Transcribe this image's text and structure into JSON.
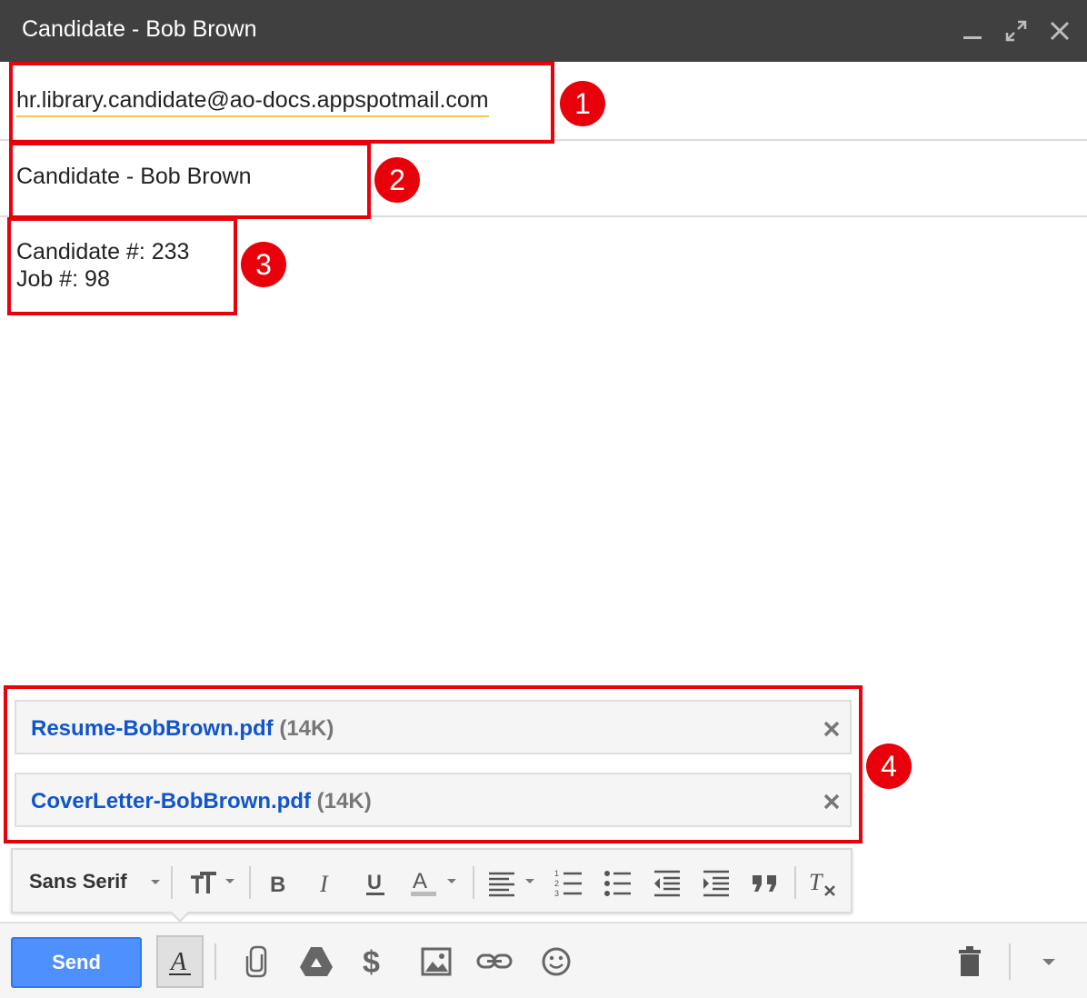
{
  "window": {
    "title": "Candidate - Bob Brown",
    "controls": [
      "minimize-icon",
      "expand-icon",
      "close-icon"
    ],
    "title_bar_color": "#404040"
  },
  "compose": {
    "to_value": "hr.library.candidate@ao-docs.appspotmail.com",
    "subject_value": "Candidate - Bob Brown",
    "body_lines": [
      "Candidate #: 233",
      "Job #: 98"
    ]
  },
  "annotations": {
    "color": "#e8000b",
    "labels": [
      "1",
      "2",
      "3",
      "4"
    ]
  },
  "attachments": [
    {
      "name": "Resume-BobBrown.pdf",
      "size": "(14K)"
    },
    {
      "name": "CoverLetter-BobBrown.pdf",
      "size": "(14K)"
    }
  ],
  "formatting_toolbar": {
    "font": "Sans Serif",
    "icons": [
      "font-size-icon",
      "bold-icon",
      "italic-icon",
      "underline-icon",
      "text-color-icon",
      "align-icon",
      "numbered-list-icon",
      "bulleted-list-icon",
      "indent-less-icon",
      "indent-more-icon",
      "quote-icon",
      "remove-formatting-icon"
    ]
  },
  "bottom_bar": {
    "send_label": "Send",
    "send_color": "#4d90fe",
    "icons": [
      "formatting-toggle-icon",
      "attach-icon",
      "drive-icon",
      "money-icon",
      "photo-icon",
      "link-icon",
      "emoji-icon",
      "trash-icon",
      "more-options-icon"
    ]
  },
  "colors": {
    "link_blue": "#1155cc",
    "size_grey": "#777777"
  }
}
